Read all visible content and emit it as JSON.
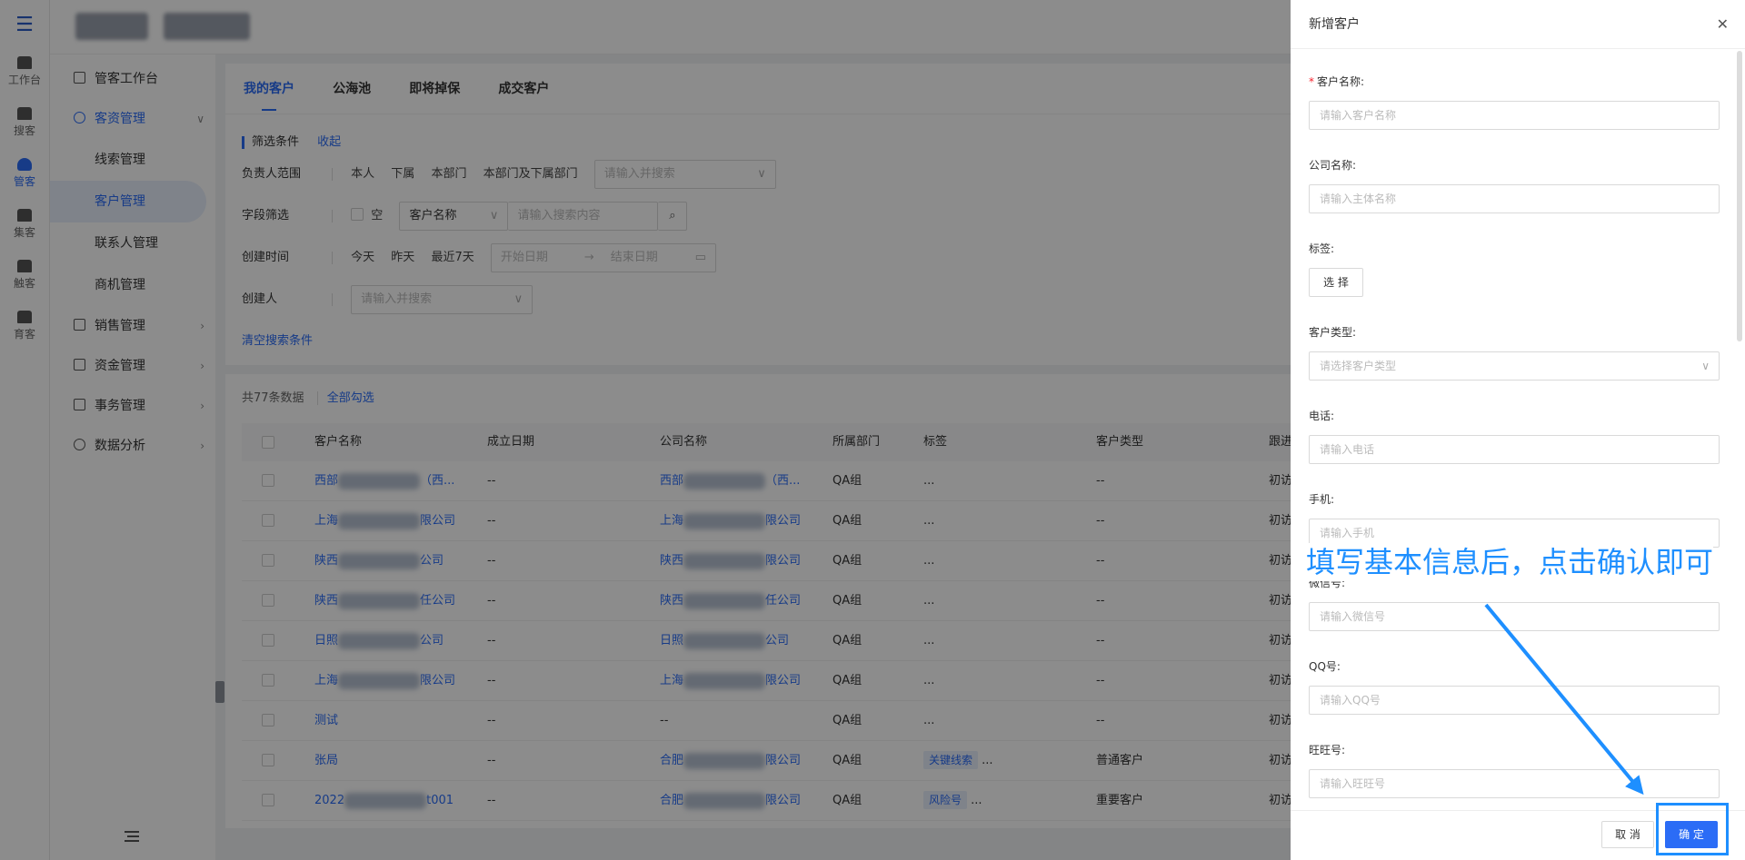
{
  "rail": {
    "items": [
      {
        "label": "工作台",
        "icon": "workbench-icon"
      },
      {
        "label": "搜客",
        "icon": "search-customer-icon"
      },
      {
        "label": "管客",
        "icon": "cloud-icon"
      },
      {
        "label": "集客",
        "icon": "group-icon"
      },
      {
        "label": "触客",
        "icon": "contact-icon"
      },
      {
        "label": "育客",
        "icon": "nurture-icon"
      }
    ]
  },
  "sidebar": {
    "workbench": "管客工作台",
    "resource_mgmt": "客资管理",
    "subitems": [
      "线索管理",
      "客户管理",
      "联系人管理",
      "商机管理"
    ],
    "sales_mgmt": "销售管理",
    "fund_mgmt": "资金管理",
    "affair_mgmt": "事务管理",
    "data_analysis": "数据分析"
  },
  "tabs": [
    "我的客户",
    "公海池",
    "即将掉保",
    "成交客户"
  ],
  "filters": {
    "title": "筛选条件",
    "collapse": "收起",
    "owner_label": "负责人范围",
    "owner_opts": [
      "本人",
      "下属",
      "本部门",
      "本部门及下属部门"
    ],
    "owner_placeholder": "请输入并搜索",
    "field_label": "字段筛选",
    "empty_label": "空",
    "field_select": "客户名称",
    "field_placeholder": "请输入搜索内容",
    "time_label": "创建时间",
    "time_opts": [
      "今天",
      "昨天",
      "最近7天"
    ],
    "start_date": "开始日期",
    "end_date": "结束日期",
    "creator_label": "创建人",
    "creator_placeholder": "请输入并搜索",
    "clear": "清空搜索条件"
  },
  "table": {
    "count_text": "共77条数据",
    "select_all": "全部勾选",
    "headers": [
      "客户名称",
      "成立日期",
      "公司名称",
      "所属部门",
      "标签",
      "客户类型",
      "跟进"
    ],
    "rows": [
      {
        "name": "西部",
        "name_tail": "（西...",
        "date": "--",
        "company": "西部",
        "company_tail": "（西...",
        "dept": "QA组",
        "tag": "",
        "tag_more": "...",
        "type": "--",
        "follow": "初访"
      },
      {
        "name": "上海",
        "name_tail": "限公司",
        "date": "--",
        "company": "上海",
        "company_tail": "限公司",
        "dept": "QA组",
        "tag": "",
        "tag_more": "...",
        "type": "--",
        "follow": "初访"
      },
      {
        "name": "陕西",
        "name_tail": "公司",
        "date": "--",
        "company": "陕西",
        "company_tail": "限公司",
        "dept": "QA组",
        "tag": "",
        "tag_more": "...",
        "type": "--",
        "follow": "初访"
      },
      {
        "name": "陕西",
        "name_tail": "任公司",
        "date": "--",
        "company": "陕西",
        "company_tail": "任公司",
        "dept": "QA组",
        "tag": "",
        "tag_more": "...",
        "type": "--",
        "follow": "初访"
      },
      {
        "name": "日照",
        "name_tail": "公司",
        "date": "--",
        "company": "日照",
        "company_tail": "公司",
        "dept": "QA组",
        "tag": "",
        "tag_more": "...",
        "type": "--",
        "follow": "初访"
      },
      {
        "name": "上海",
        "name_tail": "限公司",
        "date": "--",
        "company": "上海",
        "company_tail": "限公司",
        "dept": "QA组",
        "tag": "",
        "tag_more": "...",
        "type": "--",
        "follow": "初访"
      },
      {
        "name": "测试",
        "name_tail": "",
        "date": "--",
        "company": "--",
        "company_tail": "",
        "dept": "QA组",
        "tag": "",
        "tag_more": "...",
        "type": "--",
        "follow": "初访"
      },
      {
        "name": "张局",
        "name_tail": "",
        "date": "--",
        "company": "合肥",
        "company_tail": "限公司",
        "dept": "QA组",
        "tag": "关键线索",
        "tag_more": "...",
        "type": "普通客户",
        "follow": "初访"
      },
      {
        "name": "2022",
        "name_tail": "t001",
        "date": "--",
        "company": "合肥",
        "company_tail": "限公司",
        "dept": "QA组",
        "tag": "风险号",
        "tag_more": "...",
        "type": "重要客户",
        "follow": "初访"
      }
    ]
  },
  "drawer": {
    "title": "新增客户",
    "fields": [
      {
        "label": "客户名称:",
        "required": true,
        "placeholder": "请输入客户名称",
        "kind": "input"
      },
      {
        "label": "公司名称:",
        "required": false,
        "placeholder": "请输入主体名称",
        "kind": "input"
      },
      {
        "label": "标签:",
        "required": false,
        "placeholder": "选 择",
        "kind": "button"
      },
      {
        "label": "客户类型:",
        "required": false,
        "placeholder": "请选择客户类型",
        "kind": "select"
      },
      {
        "label": "电话:",
        "required": false,
        "placeholder": "请输入电话",
        "kind": "input"
      },
      {
        "label": "手机:",
        "required": false,
        "placeholder": "请输入手机",
        "kind": "input"
      },
      {
        "label": "微信号:",
        "required": false,
        "placeholder": "请输入微信号",
        "kind": "input"
      },
      {
        "label": "QQ号:",
        "required": false,
        "placeholder": "请输入QQ号",
        "kind": "input"
      },
      {
        "label": "旺旺号:",
        "required": false,
        "placeholder": "请输入旺旺号",
        "kind": "input"
      }
    ],
    "cancel": "取 消",
    "confirm": "确 定"
  },
  "annotation": "填写基本信息后，点击确认即可",
  "colors": {
    "accent": "#2b6cf6",
    "annotation": "#1e8fff",
    "overlay": "rgba(0,0,0,0.45)"
  }
}
